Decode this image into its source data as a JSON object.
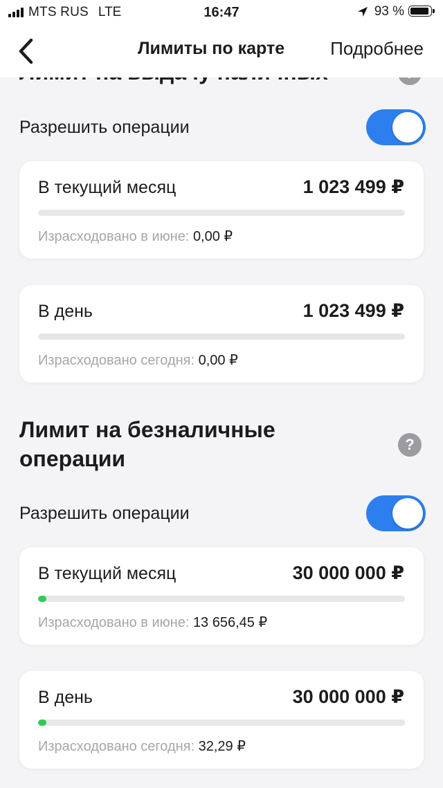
{
  "status_bar": {
    "carrier": "MTS RUS",
    "network": "LTE",
    "time": "16:47",
    "battery_text": "93 %",
    "battery_level": 0.93
  },
  "nav": {
    "title": "Лимиты по карте",
    "more_label": "Подробнее"
  },
  "cash": {
    "title": "Лимит на выдачу наличных",
    "help": "?",
    "toggle_label": "Разрешить операции",
    "toggle_on": true,
    "month": {
      "label": "В текущий месяц",
      "amount": "1 023 499 ₽",
      "spent_label": "Израсходовано в июне:",
      "spent_value": "0,00 ₽",
      "progress": 0
    },
    "day": {
      "label": "В день",
      "amount": "1 023 499 ₽",
      "spent_label": "Израсходовано сегодня:",
      "spent_value": "0,00 ₽",
      "progress": 0
    }
  },
  "cashless": {
    "title_line1": "Лимит на безналичные",
    "title_line2": "операции",
    "help": "?",
    "toggle_label": "Разрешить операции",
    "toggle_on": true,
    "month": {
      "label": "В текущий месяц",
      "amount": "30 000 000 ₽",
      "spent_label": "Израсходовано в июне:",
      "spent_value": "13 656,45 ₽",
      "progress": 0.0005
    },
    "day": {
      "label": "В день",
      "amount": "30 000 000 ₽",
      "spent_label": "Израсходовано сегодня:",
      "spent_value": "32,29 ₽",
      "progress": 1e-06
    }
  },
  "colors": {
    "accent": "#2d7ff0",
    "progress": "#2ecc55",
    "muted_text": "#a6a6ab"
  }
}
